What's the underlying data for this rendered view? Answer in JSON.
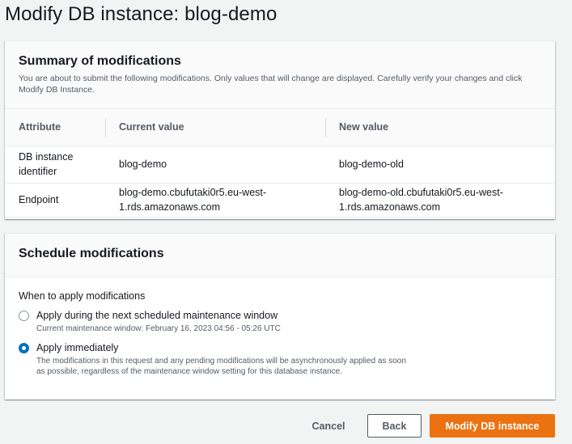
{
  "page": {
    "title": "Modify DB instance: blog-demo"
  },
  "summary": {
    "title": "Summary of modifications",
    "description": "You are about to submit the following modifications. Only values that will change are displayed. Carefully verify your changes and click Modify DB Instance.",
    "columns": [
      "Attribute",
      "Current value",
      "New value"
    ],
    "rows": [
      {
        "attribute": "DB instance identifier",
        "current": "blog-demo",
        "new": "blog-demo-old"
      },
      {
        "attribute": "Endpoint",
        "current": "blog-demo.cbufutaki0r5.eu-west-1.rds.amazonaws.com",
        "new": "blog-demo-old.cbufutaki0r5.eu-west-1.rds.amazonaws.com"
      }
    ]
  },
  "schedule": {
    "title": "Schedule modifications",
    "field_label": "When to apply modifications",
    "options": [
      {
        "label": "Apply during the next scheduled maintenance window",
        "description": "Current maintenance window: February 16, 2023 04:56 - 05:26 UTC",
        "selected": false
      },
      {
        "label": "Apply immediately",
        "description": "The modifications in this request and any pending modifications will be asynchronously applied as soon as possible, regardless of the maintenance window setting for this database instance.",
        "selected": true
      }
    ]
  },
  "actions": {
    "cancel_label": "Cancel",
    "back_label": "Back",
    "submit_label": "Modify DB instance"
  },
  "colors": {
    "primary_button": "#ec7211",
    "radio_selected": "#0073bb",
    "background": "#f2f3f3"
  }
}
